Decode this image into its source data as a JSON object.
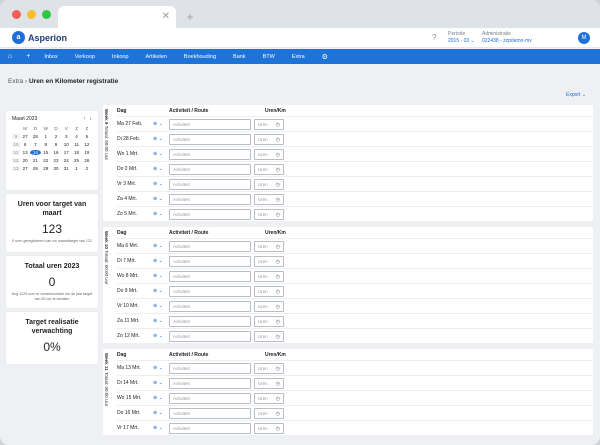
{
  "header": {
    "logo_text": "Asperion",
    "periode_label": "Periode",
    "periode_value": "2015 · 03 ⌄",
    "admin_label": "Administratie",
    "admin_value": "022438 - zzpdemo-mv",
    "avatar": "M"
  },
  "nav": [
    "Inbox",
    "Verkoop",
    "Inkoop",
    "Artikelen",
    "Boekhouding",
    "Bank",
    "BTW",
    "Extra"
  ],
  "breadcrumb": {
    "parent": "Extra",
    "current": "Uren en Kilometer registratie"
  },
  "export_label": "Export ⌄",
  "calendar": {
    "month": "Maart 2023",
    "days": [
      "M",
      "D",
      "W",
      "D",
      "V",
      "Z",
      "Z"
    ],
    "weeks": [
      {
        "wk": "9",
        "d": [
          "27",
          "28",
          "1",
          "2",
          "3",
          "4",
          "5"
        ]
      },
      {
        "wk": "10",
        "d": [
          "6",
          "7",
          "8",
          "9",
          "10",
          "11",
          "12"
        ]
      },
      {
        "wk": "11",
        "d": [
          "13",
          "14",
          "15",
          "16",
          "17",
          "18",
          "19"
        ]
      },
      {
        "wk": "12",
        "d": [
          "20",
          "21",
          "22",
          "23",
          "24",
          "25",
          "26"
        ]
      },
      {
        "wk": "13",
        "d": [
          "27",
          "28",
          "29",
          "30",
          "31",
          "1",
          "2"
        ]
      }
    ]
  },
  "stats": [
    {
      "title": "Uren voor target van maart",
      "value": "123",
      "sub": "0 uren geregistreerd van uw maandtarget van 123"
    },
    {
      "title": "Totaal uren 2023",
      "value": "0",
      "sub": "Nog 1229 uren te verantwoorden om de jaar target van 50 uur te behalen"
    },
    {
      "title": "Target realisatie verwachting",
      "value": "0%",
      "sub": ""
    }
  ],
  "columns": {
    "day": "Dag",
    "activity": "Activiteit / Route",
    "hours": "Uren/Km"
  },
  "placeholders": {
    "activity": "Activiteit",
    "hours": "Uren"
  },
  "weeks": [
    {
      "label": "Week 9",
      "total": "Totaal: 00:00 Uur",
      "days": [
        "Ma 27 Feb.",
        "Di 28 Feb.",
        "Wo 1 Mrt.",
        "Do 2 Mrt.",
        "Vr 3 Mrt.",
        "Za 4 Mrt.",
        "Zo 5 Mrt."
      ]
    },
    {
      "label": "Week 10",
      "total": "Totaal: 00:00 Uur",
      "days": [
        "Ma 6 Mrt.",
        "Di 7 Mrt.",
        "Wo 8 Mrt.",
        "Do 9 Mrt.",
        "Vr 10 Mrt.",
        "Za 11 Mrt.",
        "Zo 12 Mrt."
      ]
    },
    {
      "label": "Week 11",
      "total": "Totaal: 00:00 Uur",
      "days": [
        "Ma 13 Mrt.",
        "Di 14 Mrt.",
        "Wo 15 Mrt.",
        "Do 16 Mrt.",
        "Vr 17 Mrt."
      ]
    }
  ]
}
